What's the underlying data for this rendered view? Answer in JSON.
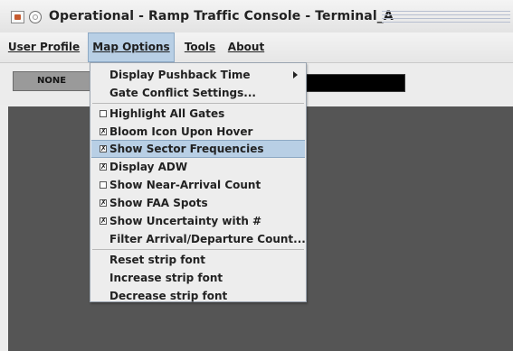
{
  "window": {
    "title": "Operational - Ramp Traffic Console - Terminal_A"
  },
  "menubar": {
    "items": [
      {
        "label": "User Profile"
      },
      {
        "label": "Map Options"
      },
      {
        "label": "Tools"
      },
      {
        "label": "About"
      }
    ]
  },
  "toolbar": {
    "none_label": "NONE"
  },
  "map_options_menu": {
    "items": [
      {
        "label": "Display Pushback Time",
        "has_submenu": true
      },
      {
        "label": "Gate Conflict Settings..."
      },
      {
        "label": "Highlight All Gates",
        "checked": false
      },
      {
        "label": "Bloom Icon Upon Hover",
        "checked": true
      },
      {
        "label": "Show Sector Frequencies",
        "checked": true,
        "highlighted": true
      },
      {
        "label": "Display ADW",
        "checked": true
      },
      {
        "label": "Show Near-Arrival Count",
        "checked": false
      },
      {
        "label": "Show FAA Spots",
        "checked": true
      },
      {
        "label": "Show Uncertainty with #",
        "checked": true
      },
      {
        "label": "Filter Arrival/Departure Count..."
      },
      {
        "label": "Reset strip font"
      },
      {
        "label": "Increase strip font"
      },
      {
        "label": "Decrease strip font"
      }
    ],
    "check_glyph": "✗"
  },
  "colors": {
    "highlight": "#b8cfe5",
    "panel": "#555555",
    "none_button": "#9a9a9a"
  },
  "icons": [
    "app-window-icon",
    "circle-menu-icon",
    "submenu-arrow-icon",
    "checkbox-icon"
  ]
}
